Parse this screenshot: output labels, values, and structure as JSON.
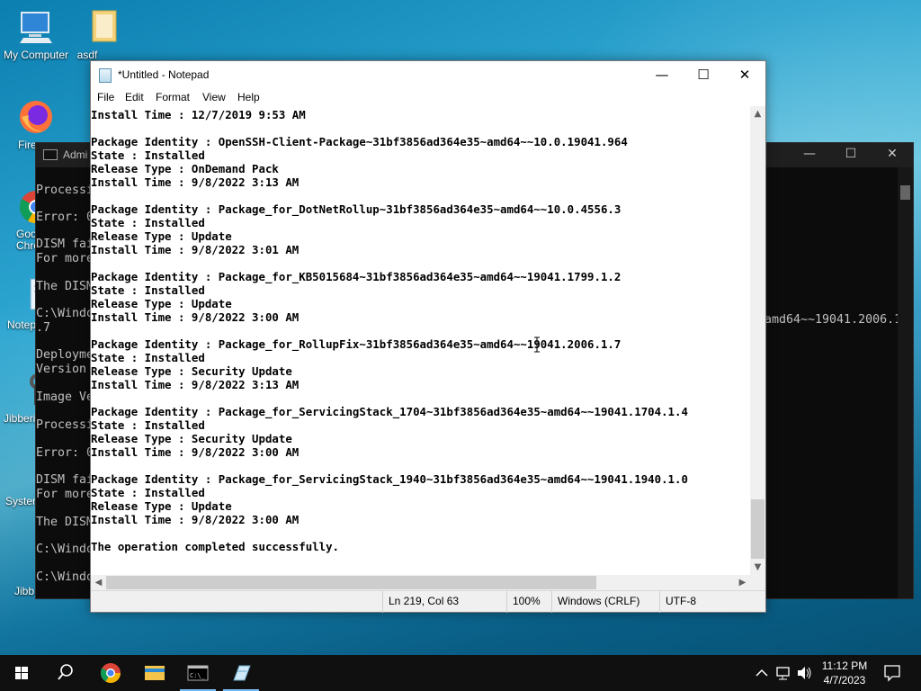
{
  "desktop": {
    "icons": [
      {
        "label": "My Computer"
      },
      {
        "label": "asdf"
      },
      {
        "label": "Fire"
      },
      {
        "label": "Goo Chro"
      },
      {
        "label": "Notep"
      },
      {
        "label": "Jibberi"
      },
      {
        "label": "Syster"
      },
      {
        "label": "Jibb"
      }
    ]
  },
  "console": {
    "title": "Admi",
    "lines": [
      "Processi",
      "",
      "Error: 0",
      "",
      "DISM fai",
      "For more",
      "",
      "The DISM",
      "",
      "C:\\Windo",
      ".7",
      "",
      "Deployme",
      "Version",
      "",
      "Image Ve",
      "",
      "Processi",
      "",
      "Error: 0",
      "",
      "DISM fai",
      "For more",
      "",
      "The DISM",
      "",
      "C:\\Windo",
      "",
      "C:\\Windo"
    ],
    "overflow_text": "amd64~~19041.2006.1"
  },
  "notepad": {
    "title": "*Untitled - Notepad",
    "menu": [
      "File",
      "Edit",
      "Format",
      "View",
      "Help"
    ],
    "lines": [
      "Install Time : 12/7/2019 9:53 AM",
      "",
      "Package Identity : OpenSSH-Client-Package~31bf3856ad364e35~amd64~~10.0.19041.964",
      "State : Installed",
      "Release Type : OnDemand Pack",
      "Install Time : 9/8/2022 3:13 AM",
      "",
      "Package Identity : Package_for_DotNetRollup~31bf3856ad364e35~amd64~~10.0.4556.3",
      "State : Installed",
      "Release Type : Update",
      "Install Time : 9/8/2022 3:01 AM",
      "",
      "Package Identity : Package_for_KB5015684~31bf3856ad364e35~amd64~~19041.1799.1.2",
      "State : Installed",
      "Release Type : Update",
      "Install Time : 9/8/2022 3:00 AM",
      "",
      "Package Identity : Package_for_RollupFix~31bf3856ad364e35~amd64~~19041.2006.1.7",
      "State : Installed",
      "Release Type : Security Update",
      "Install Time : 9/8/2022 3:13 AM",
      "",
      "Package Identity : Package_for_ServicingStack_1704~31bf3856ad364e35~amd64~~19041.1704.1.4",
      "State : Installed",
      "Release Type : Security Update",
      "Install Time : 9/8/2022 3:00 AM",
      "",
      "Package Identity : Package_for_ServicingStack_1940~31bf3856ad364e35~amd64~~19041.1940.1.0",
      "State : Installed",
      "Release Type : Update",
      "Install Time : 9/8/2022 3:00 AM",
      "",
      "The operation completed successfully."
    ],
    "status": {
      "position": "Ln 219, Col 63",
      "zoom": "100%",
      "line_ending": "Windows (CRLF)",
      "encoding": "UTF-8"
    }
  },
  "taskbar": {
    "time": "11:12 PM",
    "date": "4/7/2023"
  }
}
